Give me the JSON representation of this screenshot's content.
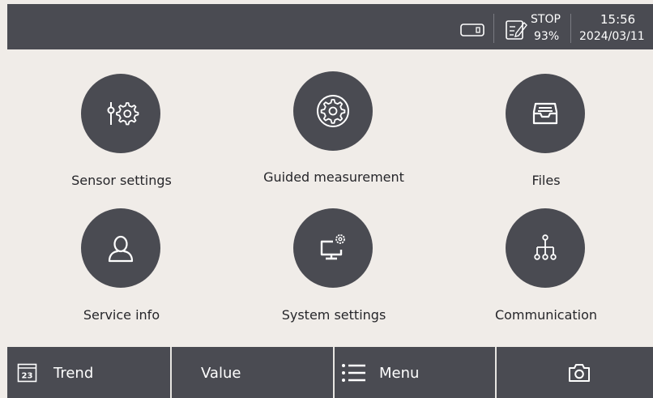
{
  "status": {
    "run_state": "STOP",
    "battery": "93%",
    "time": "15:56",
    "date": "2024/03/11"
  },
  "tiles": [
    {
      "label": "Sensor settings",
      "icon": "sensor-settings-icon"
    },
    {
      "label": "Guided measurement",
      "icon": "gear-icon"
    },
    {
      "label": "Files",
      "icon": "file-tray-icon"
    },
    {
      "label": "Service info",
      "icon": "person-icon"
    },
    {
      "label": "System settings",
      "icon": "computer-settings-icon"
    },
    {
      "label": "Communication",
      "icon": "network-icon"
    }
  ],
  "bottom_bar": {
    "trend_label": "Trend",
    "trend_icon_text": "23",
    "value_label": "Value",
    "menu_label": "Menu",
    "camera_icon": "camera-icon"
  },
  "colors": {
    "bar": "#4a4b52",
    "background": "#f0ece8",
    "text": "#26262a"
  }
}
